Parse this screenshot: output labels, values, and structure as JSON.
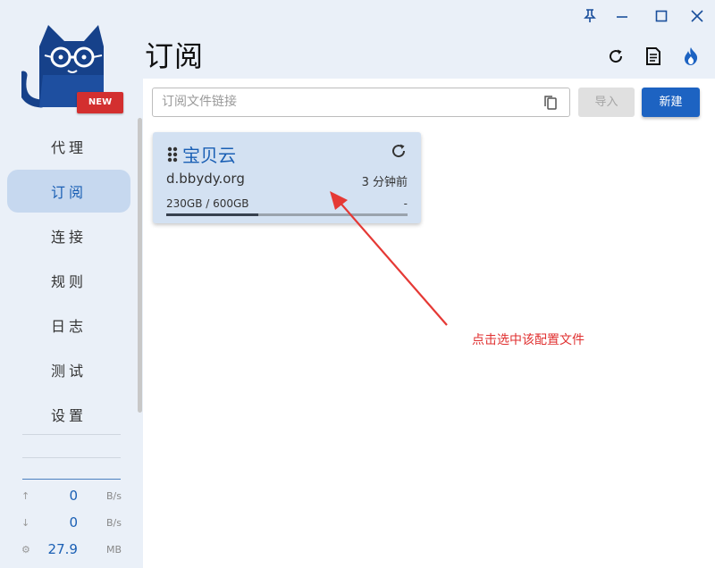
{
  "sidebar": {
    "badge": "NEW",
    "items": [
      {
        "label": "代理",
        "active": false
      },
      {
        "label": "订阅",
        "active": true
      },
      {
        "label": "连接",
        "active": false
      },
      {
        "label": "规则",
        "active": false
      },
      {
        "label": "日志",
        "active": false
      },
      {
        "label": "测试",
        "active": false
      },
      {
        "label": "设置",
        "active": false
      }
    ],
    "stats": {
      "upload": {
        "icon": "arrow-up-icon",
        "value": "0",
        "unit": "B/s"
      },
      "download": {
        "icon": "arrow-down-icon",
        "value": "0",
        "unit": "B/s"
      },
      "memory": {
        "icon": "memory-chip-icon",
        "value": "27.9",
        "unit": "MB"
      }
    }
  },
  "header": {
    "title": "订阅",
    "actions": [
      "refresh-icon",
      "document-icon",
      "fire-icon"
    ]
  },
  "window_controls": [
    "pin-icon",
    "minimize-icon",
    "maximize-icon",
    "close-icon"
  ],
  "toolbar": {
    "url_placeholder": "订阅文件链接",
    "import_label": "导入",
    "new_label": "新建"
  },
  "profile_card": {
    "name": "宝贝云",
    "url": "d.bbydy.org",
    "updated": "3 分钟前",
    "usage": "230GB / 600GB",
    "usage_fraction": 0.383,
    "expire": "-"
  },
  "annotation": {
    "text": "点击选中该配置文件",
    "color": "#e03030"
  },
  "colors": {
    "accent": "#1d63c2",
    "active_nav_bg": "#c6d8ef",
    "card_bg": "#d3e1f2"
  }
}
